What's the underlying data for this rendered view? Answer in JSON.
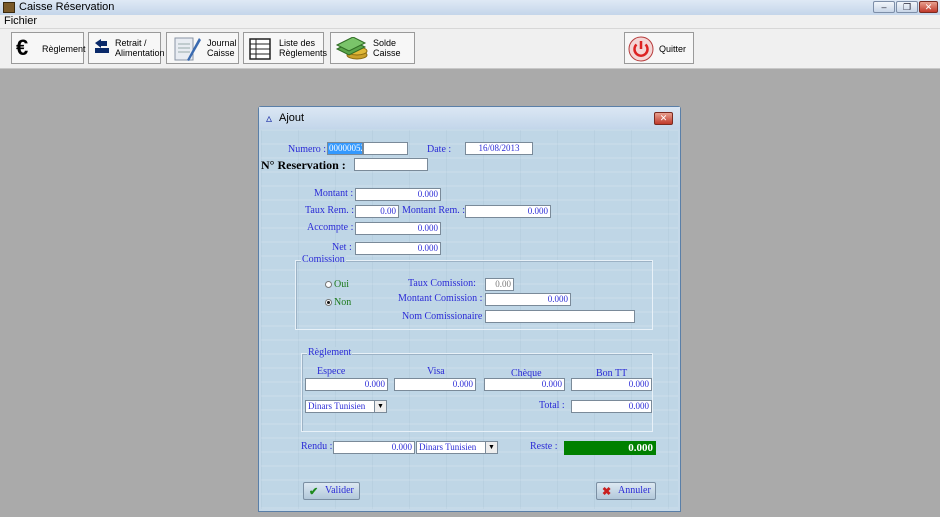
{
  "window": {
    "title": "Caisse Réservation"
  },
  "menu": {
    "items": [
      "Fichier"
    ]
  },
  "toolbar": {
    "reglement": "Règlement",
    "retrait_line1": "Retrait /",
    "retrait_line2": "Alimentation",
    "journal_line1": "Journal",
    "journal_line2": "Caisse",
    "liste_line1": "Liste des",
    "liste_line2": "Règlements",
    "solde_line1": "Solde",
    "solde_line2": "Caisse",
    "quitter": "Quitter"
  },
  "dialog": {
    "title": "Ajout",
    "numero_label": "Numero :",
    "numero_value": "00000052",
    "date_label": "Date :",
    "date_value": "16/08/2013",
    "reservation_label": "N° Reservation :",
    "reservation_value": "",
    "montant_label": "Montant :",
    "montant_value": "0.000",
    "taux_rem_label": "Taux Rem. :",
    "taux_rem_value": "0.00",
    "montant_rem_label": "Montant Rem. :",
    "montant_rem_value": "0.000",
    "accompte_label": "Accompte :",
    "accompte_value": "0.000",
    "net_label": "Net :",
    "net_value": "0.000",
    "comission": {
      "group_label": "Comission",
      "oui_label": "Oui",
      "non_label": "Non",
      "selected": "Non",
      "taux_label": "Taux Comission:",
      "taux_value": "0.00",
      "montant_label": "Montant Comission :",
      "montant_value": "0.000",
      "nom_label": "Nom Comissionaire :",
      "nom_value": ""
    },
    "reglement": {
      "group_label": "Règlement",
      "espece_label": "Espece",
      "espece_value": "0.000",
      "visa_label": "Visa",
      "visa_value": "0.000",
      "cheque_label": "Chèque",
      "cheque_value": "0.000",
      "bontt_label": "Bon TT",
      "bontt_value": "0.000",
      "devise_value": "Dinars Tunisien",
      "total_label": "Total :",
      "total_value": "0.000"
    },
    "rendu_label": "Rendu :",
    "rendu_value": "0.000",
    "rendu_devise_value": "Dinars Tunisien",
    "reste_label": "Reste :",
    "reste_value": "0.000",
    "valider_label": "Valider",
    "annuler_label": "Annuler"
  },
  "colors": {
    "label_blue": "#2b2bd6",
    "reste_green": "#008000",
    "dialog_bg": "#bfd6e6"
  }
}
